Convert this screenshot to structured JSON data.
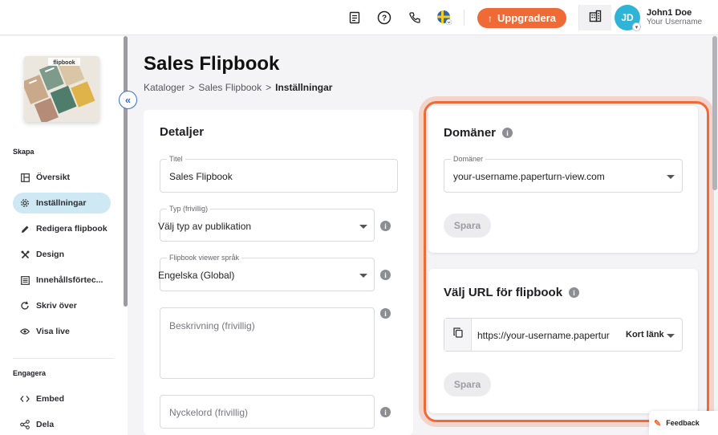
{
  "topbar": {
    "upgrade_label": "Uppgradera",
    "user_name": "John1 Doe",
    "user_subtitle": "Your Username",
    "avatar_initials": "JD"
  },
  "sidebar": {
    "section_create": "Skapa",
    "items": [
      {
        "label": "Översikt",
        "icon": "layout-icon"
      },
      {
        "label": "Inställningar",
        "icon": "gear-icon",
        "active": true
      },
      {
        "label": "Redigera flipbook",
        "icon": "pencil-icon"
      },
      {
        "label": "Design",
        "icon": "tools-icon"
      },
      {
        "label": "Innehållsförtec...",
        "icon": "toc-icon"
      },
      {
        "label": "Skriv över",
        "icon": "refresh-icon"
      },
      {
        "label": "Visa live",
        "icon": "eye-icon"
      }
    ],
    "section_engage": "Engagera",
    "engage_items": [
      {
        "label": "Embed",
        "icon": "code-icon"
      },
      {
        "label": "Dela",
        "icon": "share-icon"
      }
    ],
    "thumbnail_text": "flipbook"
  },
  "page": {
    "title": "Sales Flipbook",
    "breadcrumb": [
      "Kataloger",
      "Sales Flipbook",
      "Inställningar"
    ],
    "breadcrumb_separator": ">"
  },
  "details": {
    "title": "Detaljer",
    "title_field": {
      "label": "Titel",
      "value": "Sales Flipbook"
    },
    "type_field": {
      "label": "Typ (frivillig)",
      "value": "Välj typ av publikation"
    },
    "language_field": {
      "label": "Flipbook viewer språk",
      "value": "Engelska (Global)"
    },
    "description_placeholder": "Beskrivning (frivillig)",
    "keywords_placeholder": "Nyckelord (frivillig)"
  },
  "domains": {
    "title": "Domäner",
    "field_label": "Domäner",
    "value": "your-username.paperturn-view.com",
    "save_label": "Spara"
  },
  "url": {
    "title": "Välj URL för flipbook",
    "value": "https://your-username.papertur",
    "link_type": "Kort länk",
    "save_label": "Spara"
  },
  "feedback_label": "Feedback",
  "colors": {
    "accent": "#f06a36",
    "active": "#cfe9f4",
    "avatar": "#2fb4d8"
  }
}
